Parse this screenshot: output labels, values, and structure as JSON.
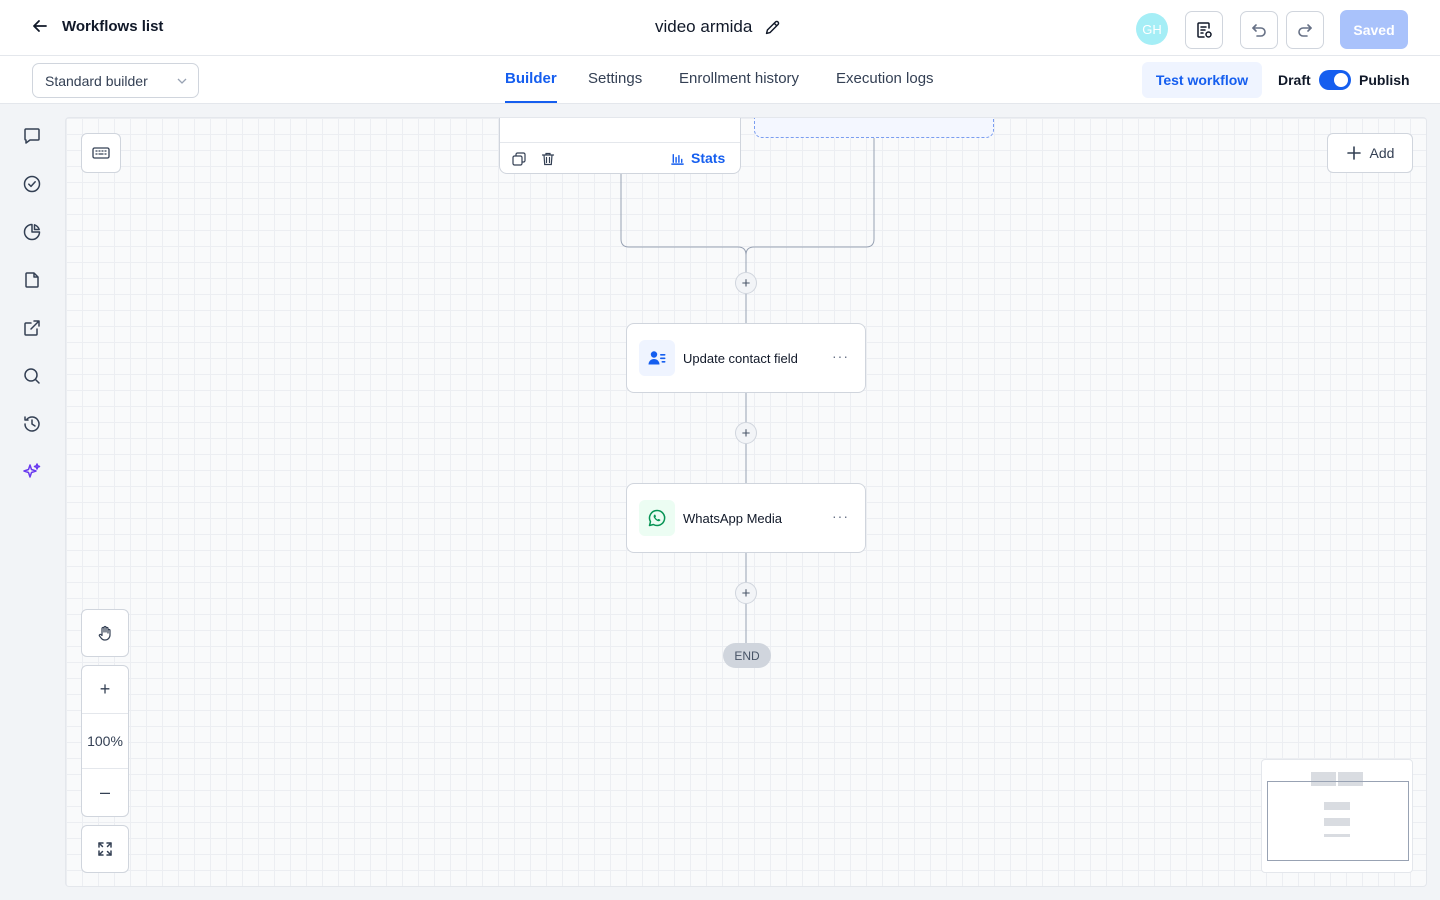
{
  "header": {
    "back_label": "Workflows list",
    "workflow_name": "video armida",
    "avatar_initials": "GH",
    "saved_label": "Saved"
  },
  "subbar": {
    "builder_select_value": "Standard builder",
    "tabs": [
      {
        "label": "Builder",
        "active": true
      },
      {
        "label": "Settings",
        "active": false
      },
      {
        "label": "Enrollment history",
        "active": false
      },
      {
        "label": "Execution logs",
        "active": false
      }
    ],
    "test_workflow_label": "Test workflow",
    "draft_label": "Draft",
    "publish_label": "Publish",
    "publish_toggle_on": true
  },
  "sidebar": {
    "icons": [
      "chat-icon",
      "check-circle-icon",
      "pie-chart-icon",
      "document-icon",
      "external-link-icon",
      "search-icon",
      "history-icon",
      "sparkles-icon"
    ]
  },
  "canvas": {
    "add_label": "Add",
    "stats_label": "Stats",
    "nodes": [
      {
        "label": "Update contact field",
        "icon": "contact-field-icon",
        "color": "#155eef"
      },
      {
        "label": "WhatsApp Media",
        "icon": "whatsapp-icon",
        "color": "#079455"
      }
    ],
    "end_label": "END",
    "zoom_level": "100%"
  },
  "colors": {
    "accent": "#155eef",
    "saved_disabled": "#a9c2fb",
    "avatar": "#a5eef6",
    "sparkle": "#6938ef"
  }
}
